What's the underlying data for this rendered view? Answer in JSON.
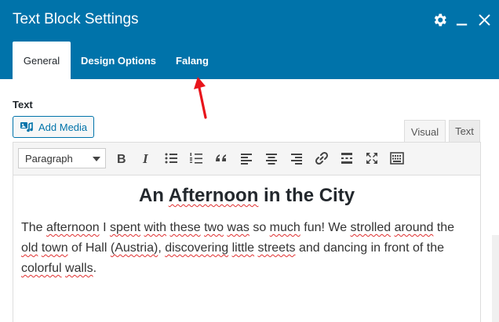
{
  "header": {
    "title": "Text Block Settings",
    "tabs": [
      {
        "label": "General",
        "active": true
      },
      {
        "label": "Design Options",
        "active": false
      },
      {
        "label": "Falang",
        "active": false
      }
    ]
  },
  "section_label": "Text",
  "add_media_label": "Add Media",
  "editor_tabs": [
    {
      "label": "Visual",
      "active": true
    },
    {
      "label": "Text",
      "active": false
    }
  ],
  "toolbar": {
    "format_selected": "Paragraph",
    "buttons": [
      "bold-icon",
      "italic-icon",
      "bullet-list-icon",
      "numbered-list-icon",
      "blockquote-icon",
      "align-left-icon",
      "align-center-icon",
      "align-right-icon",
      "link-icon",
      "read-more-icon",
      "fullscreen-icon",
      "toolbar-toggle-icon"
    ]
  },
  "content": {
    "heading": [
      "An ",
      "Afternoon",
      " in the City"
    ],
    "paragraph": [
      {
        "t": "The ",
        "s": false
      },
      {
        "t": "afternoon",
        "s": true
      },
      {
        "t": " I ",
        "s": false
      },
      {
        "t": "spent",
        "s": true
      },
      {
        "t": " ",
        "s": false
      },
      {
        "t": "with",
        "s": true
      },
      {
        "t": " ",
        "s": false
      },
      {
        "t": "these",
        "s": true
      },
      {
        "t": " ",
        "s": false
      },
      {
        "t": "two",
        "s": true
      },
      {
        "t": " ",
        "s": false
      },
      {
        "t": "was",
        "s": true
      },
      {
        "t": " so ",
        "s": false
      },
      {
        "t": "much",
        "s": true
      },
      {
        "t": " fun! We ",
        "s": false
      },
      {
        "t": "strolled",
        "s": true
      },
      {
        "t": " ",
        "s": false
      },
      {
        "t": "around",
        "s": true
      },
      {
        "t": " the ",
        "s": false
      },
      {
        "t": "old",
        "s": true
      },
      {
        "t": " ",
        "s": false
      },
      {
        "t": "town",
        "s": true
      },
      {
        "t": " of Hall ",
        "s": false
      },
      {
        "t": "(Austria)",
        "s": true
      },
      {
        "t": ", ",
        "s": false
      },
      {
        "t": "discovering",
        "s": true
      },
      {
        "t": " ",
        "s": false
      },
      {
        "t": "little",
        "s": true
      },
      {
        "t": " ",
        "s": false
      },
      {
        "t": "streets",
        "s": true
      },
      {
        "t": " and dancing in front of the ",
        "s": false
      },
      {
        "t": "colorful",
        "s": true
      },
      {
        "t": " ",
        "s": false
      },
      {
        "t": "walls",
        "s": true
      },
      {
        "t": ".",
        "s": false
      }
    ]
  },
  "colors": {
    "header_bg": "#0073aa",
    "accent": "#0073aa",
    "annotation_arrow": "#e8141b",
    "spellcheck": "#e03030"
  }
}
